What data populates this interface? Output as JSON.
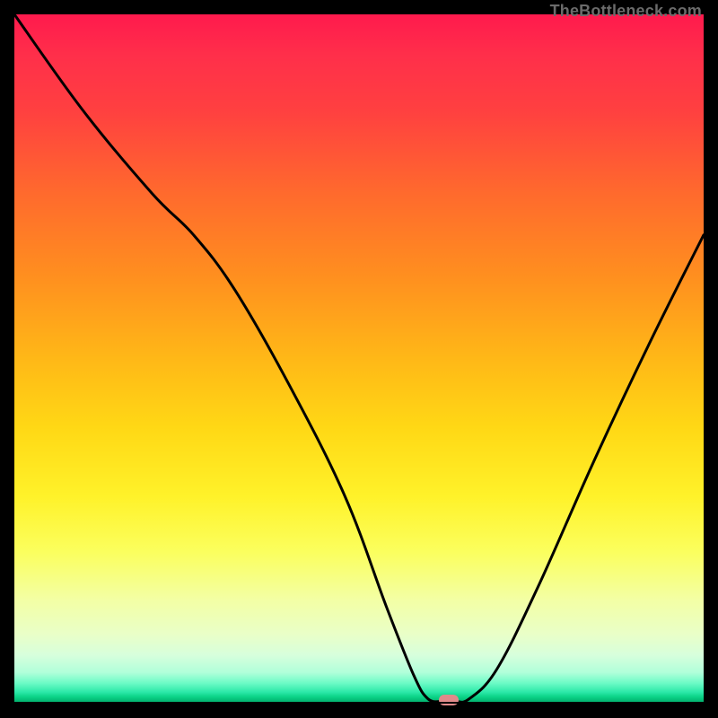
{
  "attribution": "TheBottleneck.com",
  "colors": {
    "marker_fill": "#e08a8a",
    "curve_stroke": "#000000"
  },
  "chart_data": {
    "type": "line",
    "title": "",
    "xlabel": "",
    "ylabel": "",
    "xlim": [
      0,
      100
    ],
    "ylim": [
      0,
      100
    ],
    "grid": false,
    "legend": false,
    "annotations": [
      "TheBottleneck.com"
    ],
    "marker_x": 63,
    "series": [
      {
        "name": "bottleneck-curve",
        "x": [
          0,
          10,
          20,
          26,
          32,
          40,
          48,
          54,
          58,
          60,
          62,
          64,
          66,
          70,
          76,
          84,
          92,
          100
        ],
        "values": [
          100,
          86,
          74,
          68,
          60,
          46,
          30,
          14,
          4,
          0.7,
          0.3,
          0.3,
          0.7,
          5,
          17,
          35,
          52,
          68
        ]
      }
    ]
  }
}
